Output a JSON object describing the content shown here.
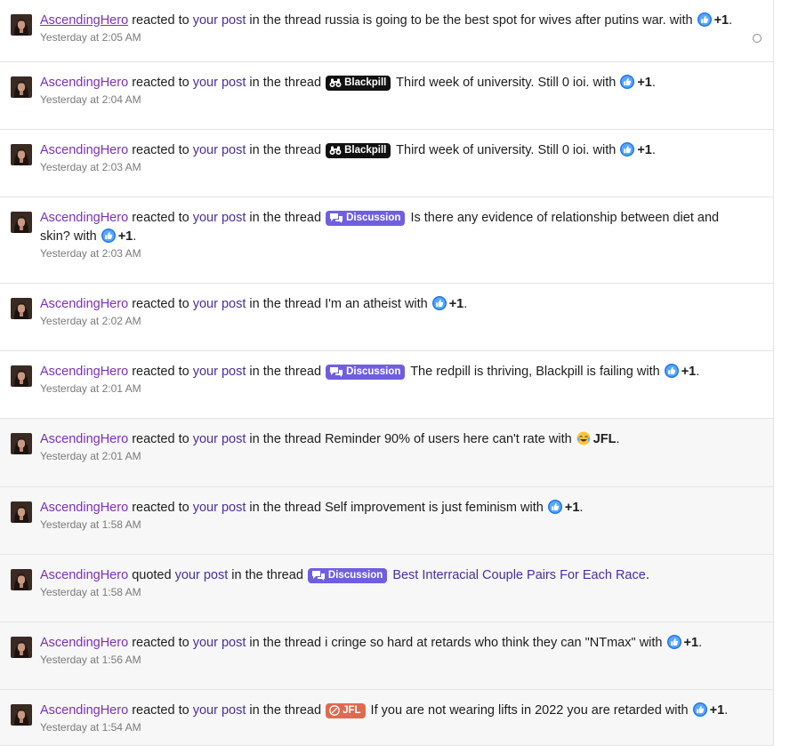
{
  "colors": {
    "username": "#7c2fbe",
    "thread_link": "#4a2fa0",
    "blackpill_prefix": "#111111",
    "discussion_prefix": "#6f5fe0",
    "jfl_prefix": "#e06a4f",
    "read_background": "#f7f7f7"
  },
  "common": {
    "username": "AscendingHero",
    "reacted": "reacted to",
    "quoted": "quoted",
    "your_post": "your post",
    "in_the_thread": "in the thread",
    "with": "with",
    "like_reaction": "+1",
    "jfl_reaction": "JFL"
  },
  "prefixes": {
    "blackpill": "Blackpill",
    "discussion": "Discussion",
    "jfl": "JFL"
  },
  "alerts": [
    {
      "thread": "russia is going to be the best spot for wives after putins war.",
      "time": "Yesterday at 2:05 AM"
    },
    {
      "thread": "Third week of university. Still 0 ioi.",
      "time": "Yesterday at 2:04 AM"
    },
    {
      "thread": "Third week of university. Still 0 ioi.",
      "time": "Yesterday at 2:03 AM"
    },
    {
      "thread": "Is there any evidence of relationship between diet and skin?",
      "time": "Yesterday at 2:03 AM"
    },
    {
      "thread": "I'm an atheist",
      "time": "Yesterday at 2:02 AM"
    },
    {
      "thread": "The redpill is thriving, Blackpill is failing",
      "time": "Yesterday at 2:01 AM"
    },
    {
      "thread": "Reminder 90% of users here can't rate",
      "time": "Yesterday at 2:01 AM"
    },
    {
      "thread": "Self improvement is just feminism",
      "time": "Yesterday at 1:58 AM"
    },
    {
      "thread": "Best Interracial Couple Pairs For Each Race",
      "time": "Yesterday at 1:58 AM"
    },
    {
      "thread": "i cringe so hard at retards who think they can \"NTmax\"",
      "time": "Yesterday at 1:56 AM"
    },
    {
      "thread": "If you are not wearing lifts in 2022 you are retarded",
      "time": "Yesterday at 1:54 AM"
    }
  ]
}
